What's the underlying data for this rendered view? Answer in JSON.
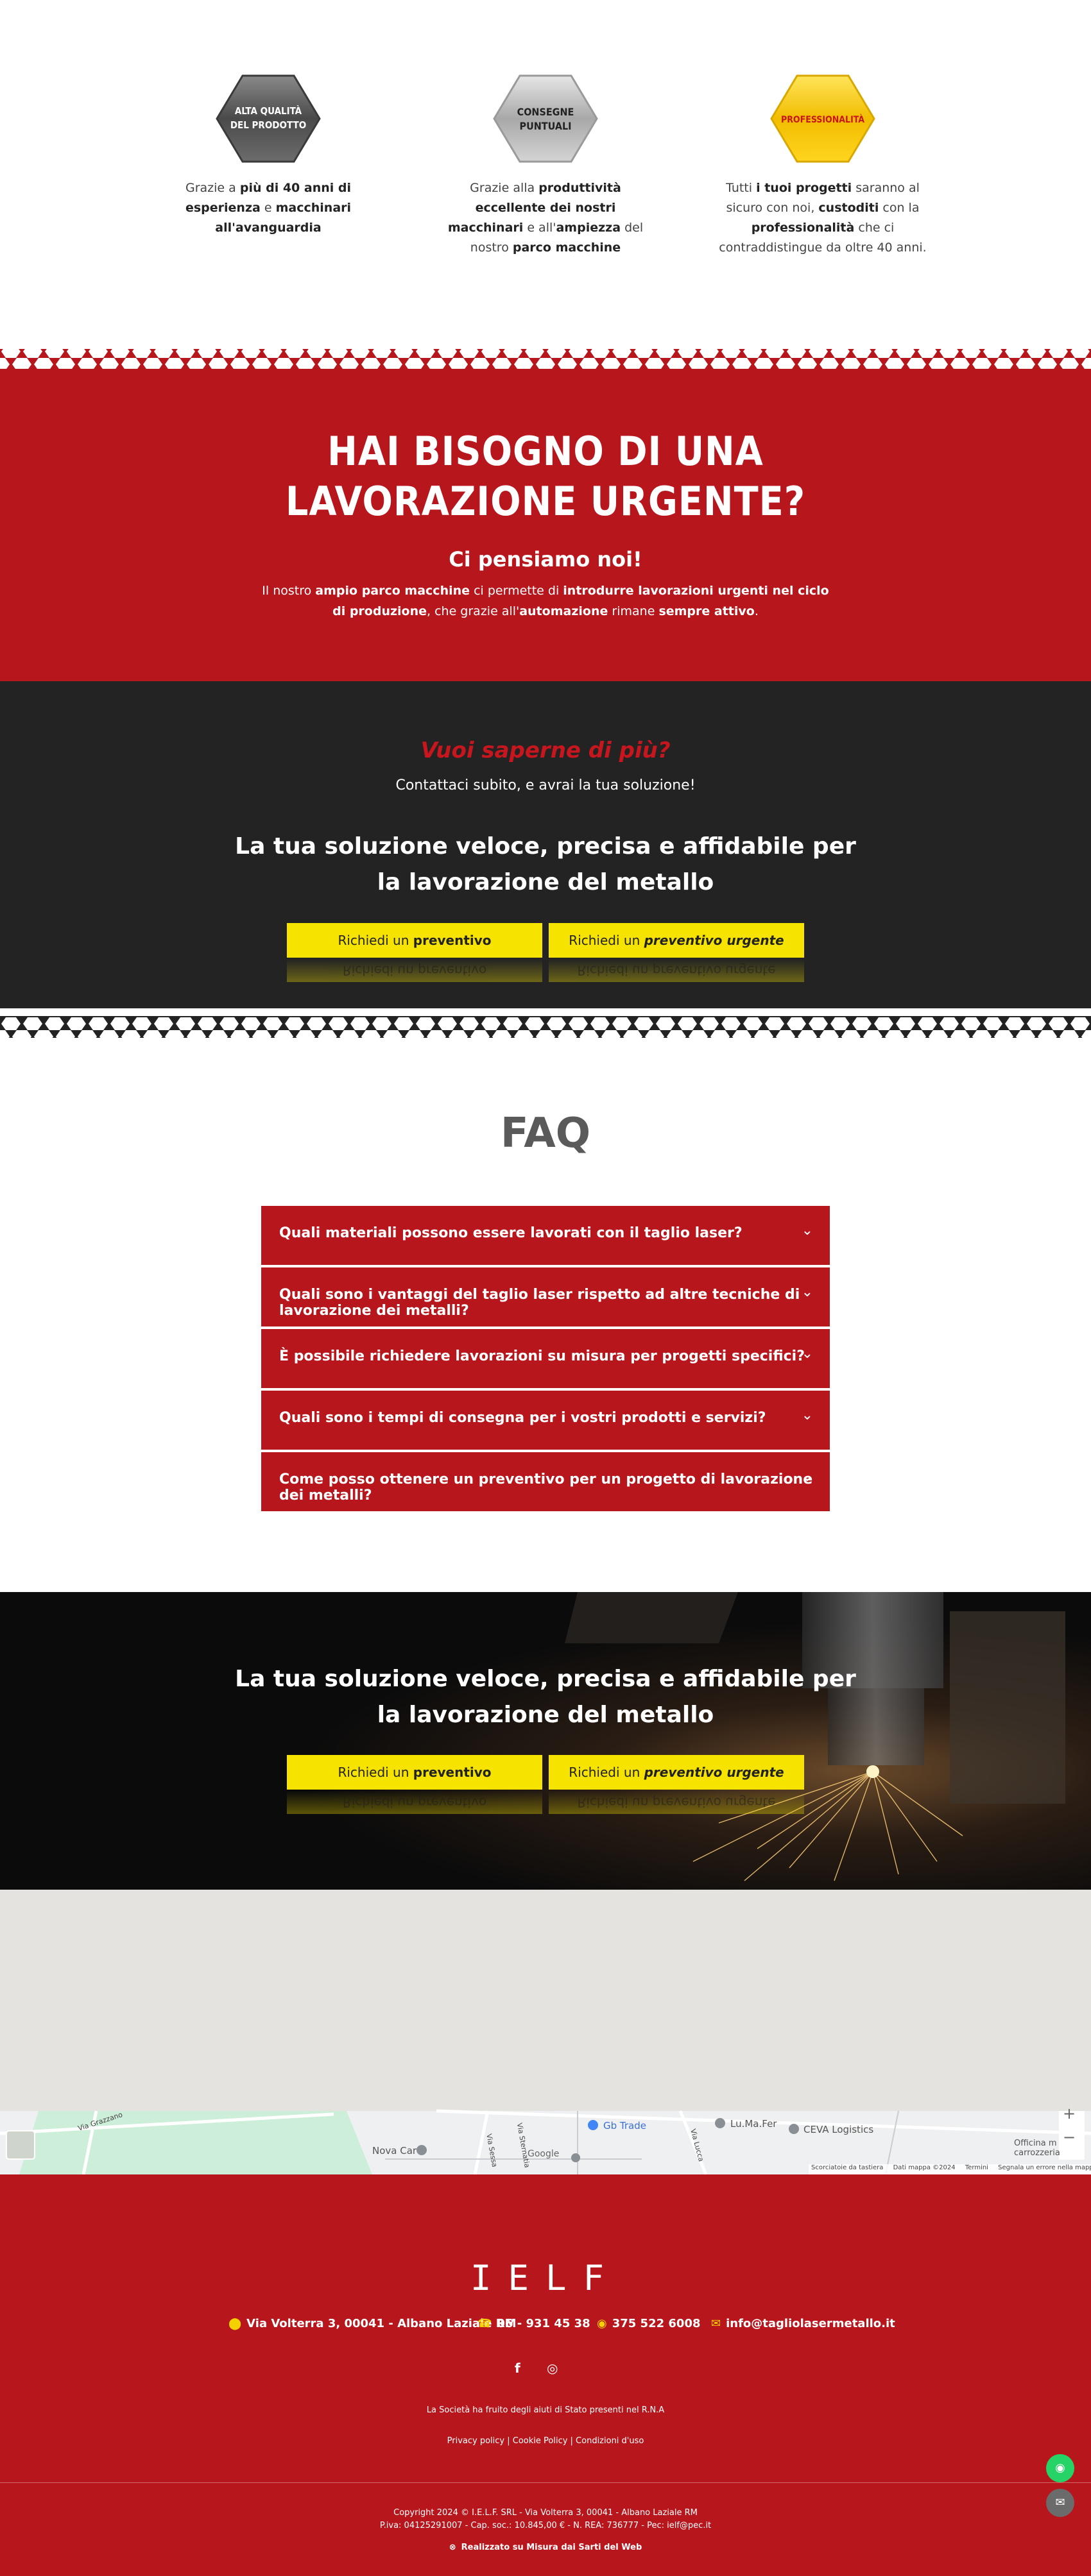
{
  "features": [
    {
      "badge_lines": [
        "ALTA QUALITÀ",
        "DEL PRODOTTO"
      ],
      "badge_color": "#555555",
      "text_parts": [
        {
          "t": "Grazie a ",
          "b": false
        },
        {
          "t": "più di 40 anni di esperienza",
          "b": true
        },
        {
          "t": " e ",
          "b": false
        },
        {
          "t": "macchinari all'avanguardia",
          "b": true
        }
      ]
    },
    {
      "badge_lines": [
        "CONSEGNE",
        "PUNTUALI"
      ],
      "badge_color": "#b9b9b9",
      "text_parts": [
        {
          "t": "Grazie alla ",
          "b": false
        },
        {
          "t": "produttività eccellente dei nostri macchinari",
          "b": true
        },
        {
          "t": " e all'",
          "b": false
        },
        {
          "t": "ampiezza",
          "b": true
        },
        {
          "t": " del nostro ",
          "b": false
        },
        {
          "t": "parco macchine",
          "b": true
        }
      ]
    },
    {
      "badge_lines": [
        "PROFESSIONALITÀ"
      ],
      "badge_color": "#f3c400",
      "text_parts": [
        {
          "t": "Tutti ",
          "b": false
        },
        {
          "t": "i tuoi progetti",
          "b": true
        },
        {
          "t": " saranno al sicuro con noi, ",
          "b": false
        },
        {
          "t": "custoditi",
          "b": true
        },
        {
          "t": " con la ",
          "b": false
        },
        {
          "t": "professionalità",
          "b": true
        },
        {
          "t": " che ci contraddistingue da oltre 40 anni.",
          "b": false
        }
      ]
    }
  ],
  "urgent": {
    "title": "HAI BISOGNO DI UNA LAVORAZIONE URGENTE?",
    "subtitle": "Ci pensiamo noi!",
    "text_parts": [
      {
        "t": "Il nostro ",
        "b": false
      },
      {
        "t": "ampio parco macchine",
        "b": true
      },
      {
        "t": " ci permette di ",
        "b": false
      },
      {
        "t": "introdurre lavorazioni urgenti nel ciclo di produzione",
        "b": true
      },
      {
        "t": ", che grazie all'",
        "b": false
      },
      {
        "t": "automazione",
        "b": true
      },
      {
        "t": " rimane ",
        "b": false
      },
      {
        "t": "sempre attivo",
        "b": true
      },
      {
        "t": ".",
        "b": false
      }
    ]
  },
  "cta": {
    "ask": "Vuoi saperne di più?",
    "sub": "Contattaci subito, e avrai la tua soluzione!",
    "headline": "La tua soluzione veloce, precisa e affidabile per la lavorazione del metallo",
    "btn1_prefix": "Richiedi un ",
    "btn1_strong": "preventivo",
    "btn2_prefix": "Richiedi un ",
    "btn2_strong": "preventivo urgente"
  },
  "faq": {
    "title": "FAQ",
    "items": [
      "Quali materiali possono essere lavorati con il taglio laser?",
      "Quali sono i vantaggi del taglio laser rispetto ad altre tecniche di lavorazione dei metalli?",
      "È possibile richiedere lavorazioni su misura per progetti specifici?",
      "Quali sono i tempi di consegna per i vostri prodotti e servizi?",
      "Come posso ottenere un preventivo per un progetto di lavorazione dei metalli?"
    ]
  },
  "laser": {
    "headline": "La tua soluzione veloce, precisa e affidabile per la lavorazione del metallo",
    "btn1_prefix": "Richiedi un ",
    "btn1_strong": "preventivo",
    "btn2_prefix": "Richiedi un ",
    "btn2_strong": "preventivo urgente"
  },
  "map": {
    "labels": [
      "Gb Trade",
      "Lu.Ma.Fer",
      "CEVA Logistics",
      "Nova Car",
      "Officina m carrozzeria"
    ],
    "street_labels": [
      "Via Sternatia",
      "Via Sessa",
      "Via Lucca",
      "Via Grazzano"
    ],
    "google": "Google",
    "footer_links": [
      "Scorciatoie da tastiera",
      "Dati mappa ©2024",
      "Termini",
      "Segnala un errore nella mappa"
    ],
    "zoom_in": "+",
    "zoom_out": "−"
  },
  "footer": {
    "logo": "IELF",
    "address": "Via Volterra 3, 00041 - Albano Laziale RM",
    "phone": "06 - 931 45 38",
    "whatsapp": "375 522 6008",
    "email": "info@tagliolasermetallo.it",
    "state_aid": "La Società ha fruito degli aiuti di Stato presenti nel R.N.A",
    "policy_links": "Privacy policy | Cookie Policy | Condizioni d'uso",
    "copyright": "Copyright 2024 © I.E.L.F. SRL - Via Volterra 3, 00041 - Albano Laziale RM",
    "fiscal": "P.iva: 04125291007 - Cap. soc.: 10.845,00 € - N. REA: 736777 - Pec: ielf@pec.it",
    "credit": "Realizzato su Misura dai Sarti del Web"
  },
  "colors": {
    "brand_red": "#b8161d",
    "dark": "#232323",
    "button_yellow": "#f6e300",
    "icon_yellow": "#f5d100",
    "whatsapp_green": "#25d366"
  },
  "icons": {
    "address": "map-pin-icon",
    "phone": "phone-icon",
    "whatsapp": "whatsapp-icon",
    "email": "envelope-icon",
    "facebook": "facebook-icon",
    "instagram": "instagram-icon",
    "faq_toggle": "chevron-down-icon",
    "credit": "sarti-logo-icon"
  }
}
